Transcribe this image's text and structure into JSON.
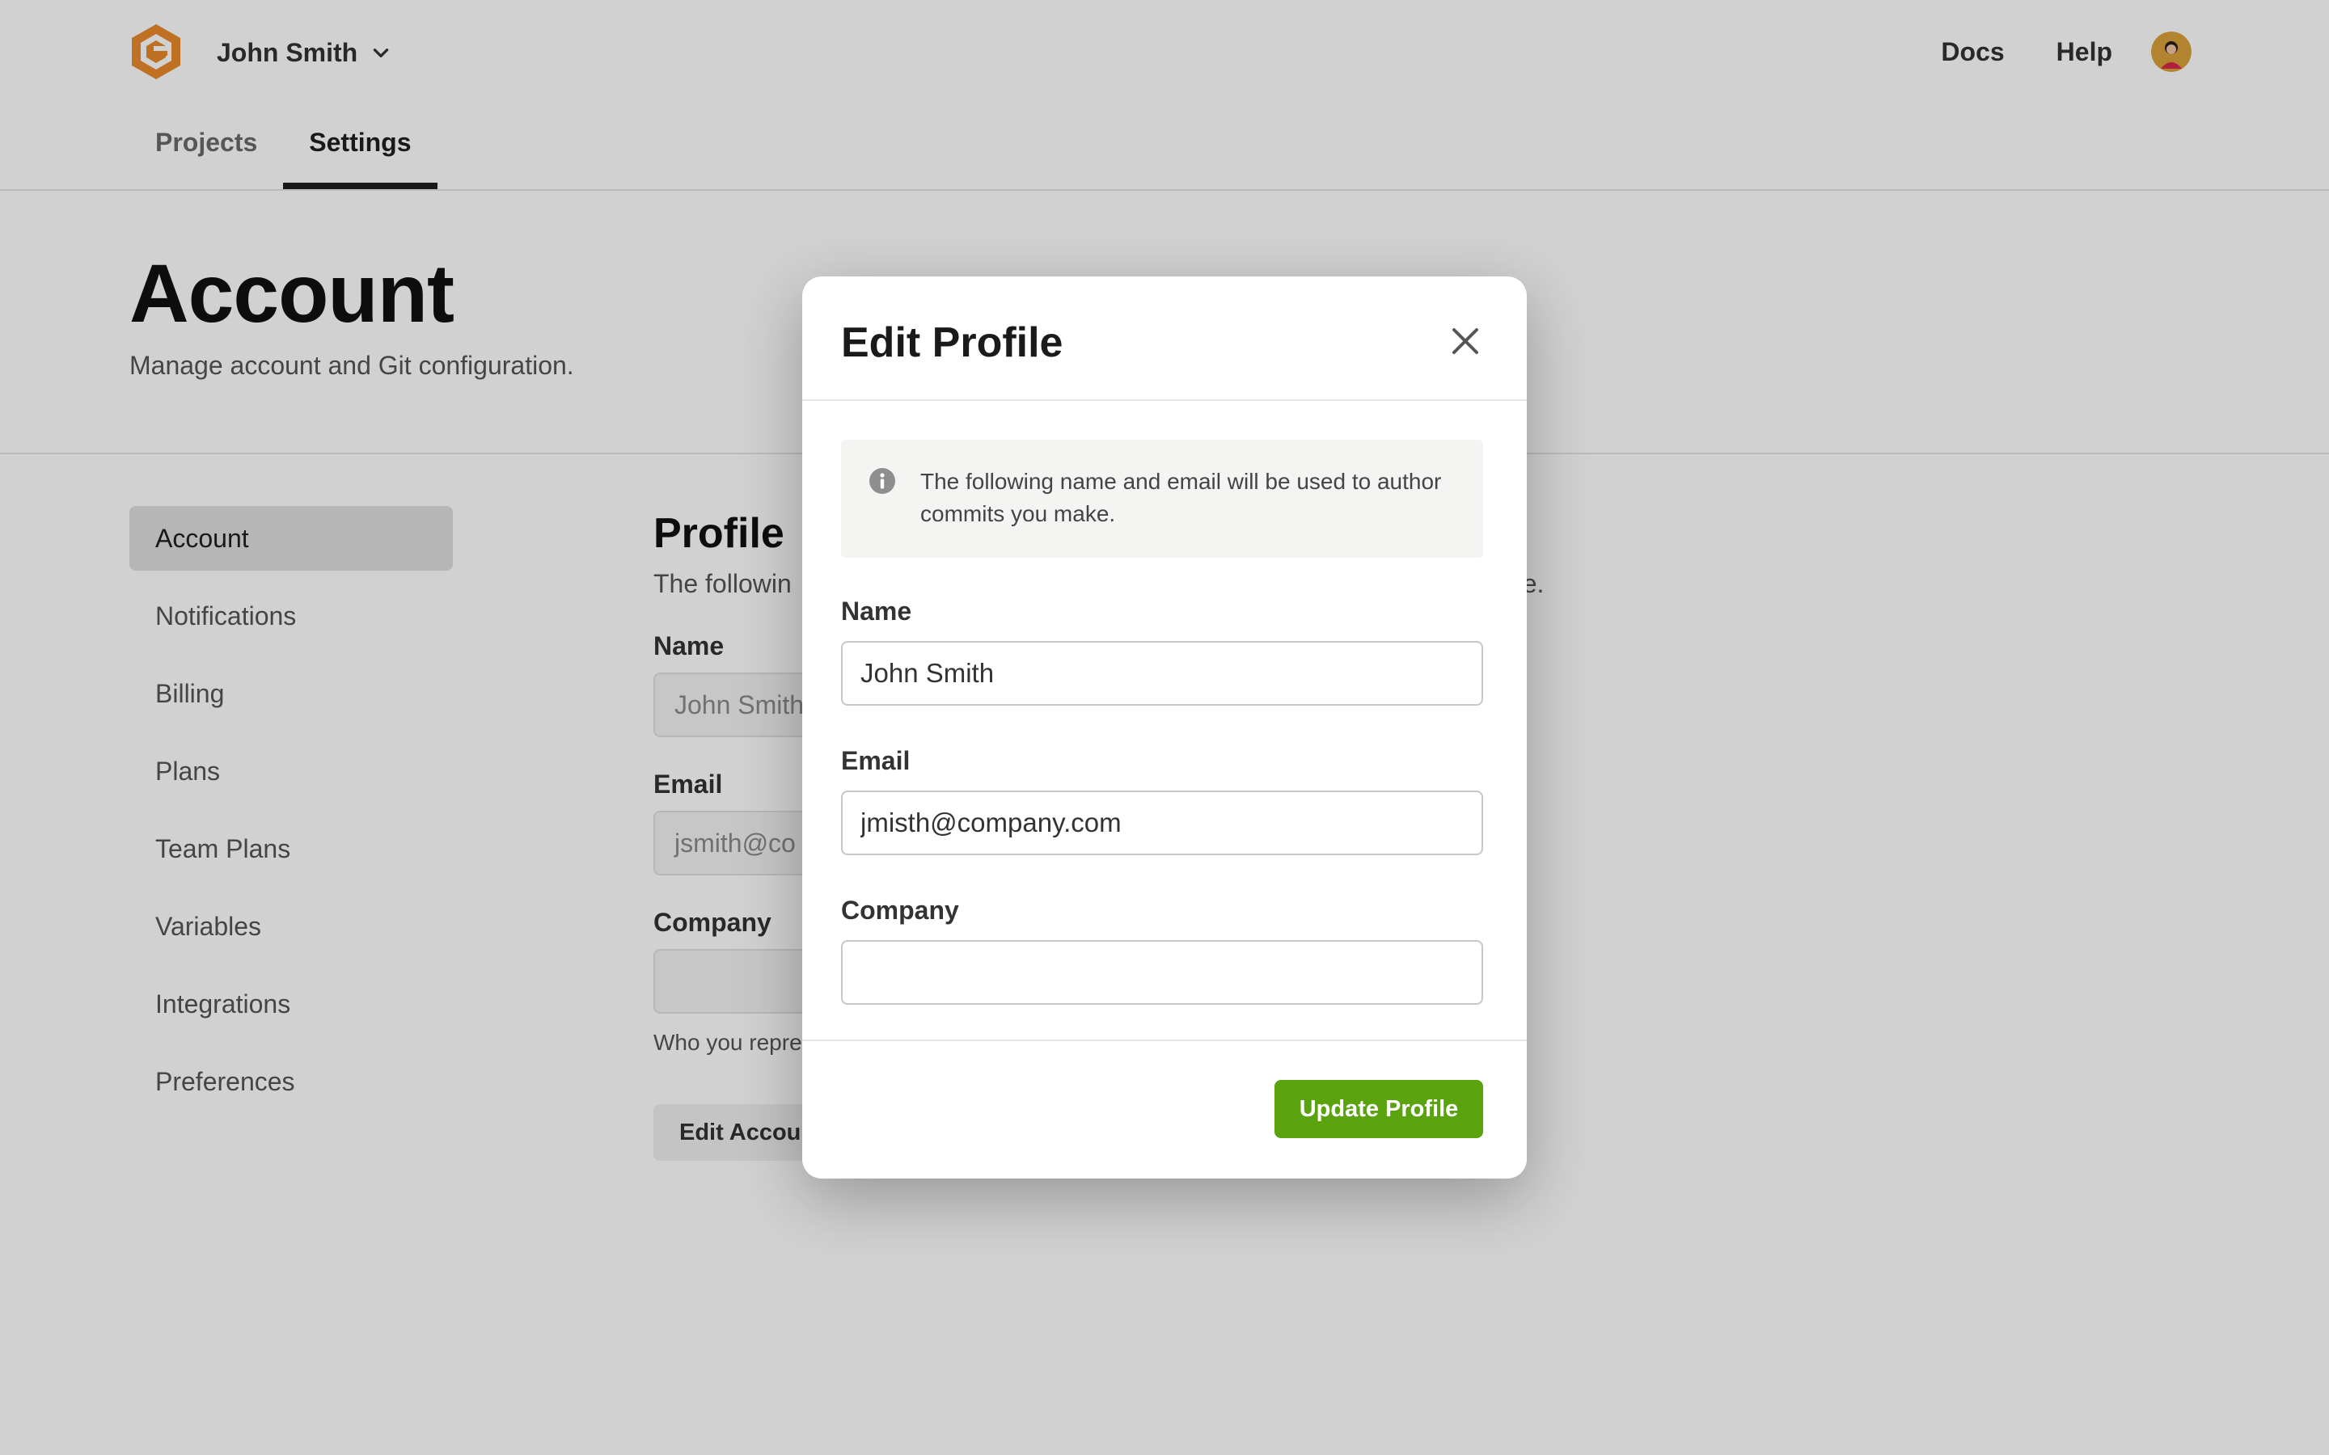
{
  "header": {
    "user_name": "John Smith",
    "nav": {
      "docs": "Docs",
      "help": "Help"
    },
    "tabs": [
      {
        "label": "Projects",
        "active": false
      },
      {
        "label": "Settings",
        "active": true
      }
    ]
  },
  "page": {
    "title": "Account",
    "subtitle": "Manage account and Git configuration."
  },
  "sidebar": {
    "items": [
      {
        "label": "Account",
        "active": true
      },
      {
        "label": "Notifications"
      },
      {
        "label": "Billing"
      },
      {
        "label": "Plans"
      },
      {
        "label": "Team Plans"
      },
      {
        "label": "Variables"
      },
      {
        "label": "Integrations"
      },
      {
        "label": "Preferences"
      }
    ]
  },
  "main": {
    "section_title": "Profile",
    "section_desc_visible_left": "The followin",
    "section_desc_visible_right": "ke.",
    "name_label": "Name",
    "name_value_visible": "John Smith",
    "email_label": "Email",
    "email_value_visible": "jsmith@co",
    "company_label": "Company",
    "company_help_visible": "Who you repre",
    "edit_button_visible": "Edit Accou"
  },
  "modal": {
    "title": "Edit Profile",
    "info_text": "The following name and email will be used to author commits you make.",
    "fields": {
      "name": {
        "label": "Name",
        "value": "John Smith"
      },
      "email": {
        "label": "Email",
        "value": "jmisth@company.com"
      },
      "company": {
        "label": "Company",
        "value": ""
      }
    },
    "submit_label": "Update Profile"
  },
  "colors": {
    "brand_logo": "#E8892B",
    "primary_button": "#5AA30F",
    "overlay": "rgba(0,0,0,0.18)"
  },
  "icons": {
    "logo": "brand-logo-icon",
    "user_menu": "chevron-down-icon",
    "close": "close-icon",
    "info": "info-icon",
    "avatar": "user-avatar"
  }
}
